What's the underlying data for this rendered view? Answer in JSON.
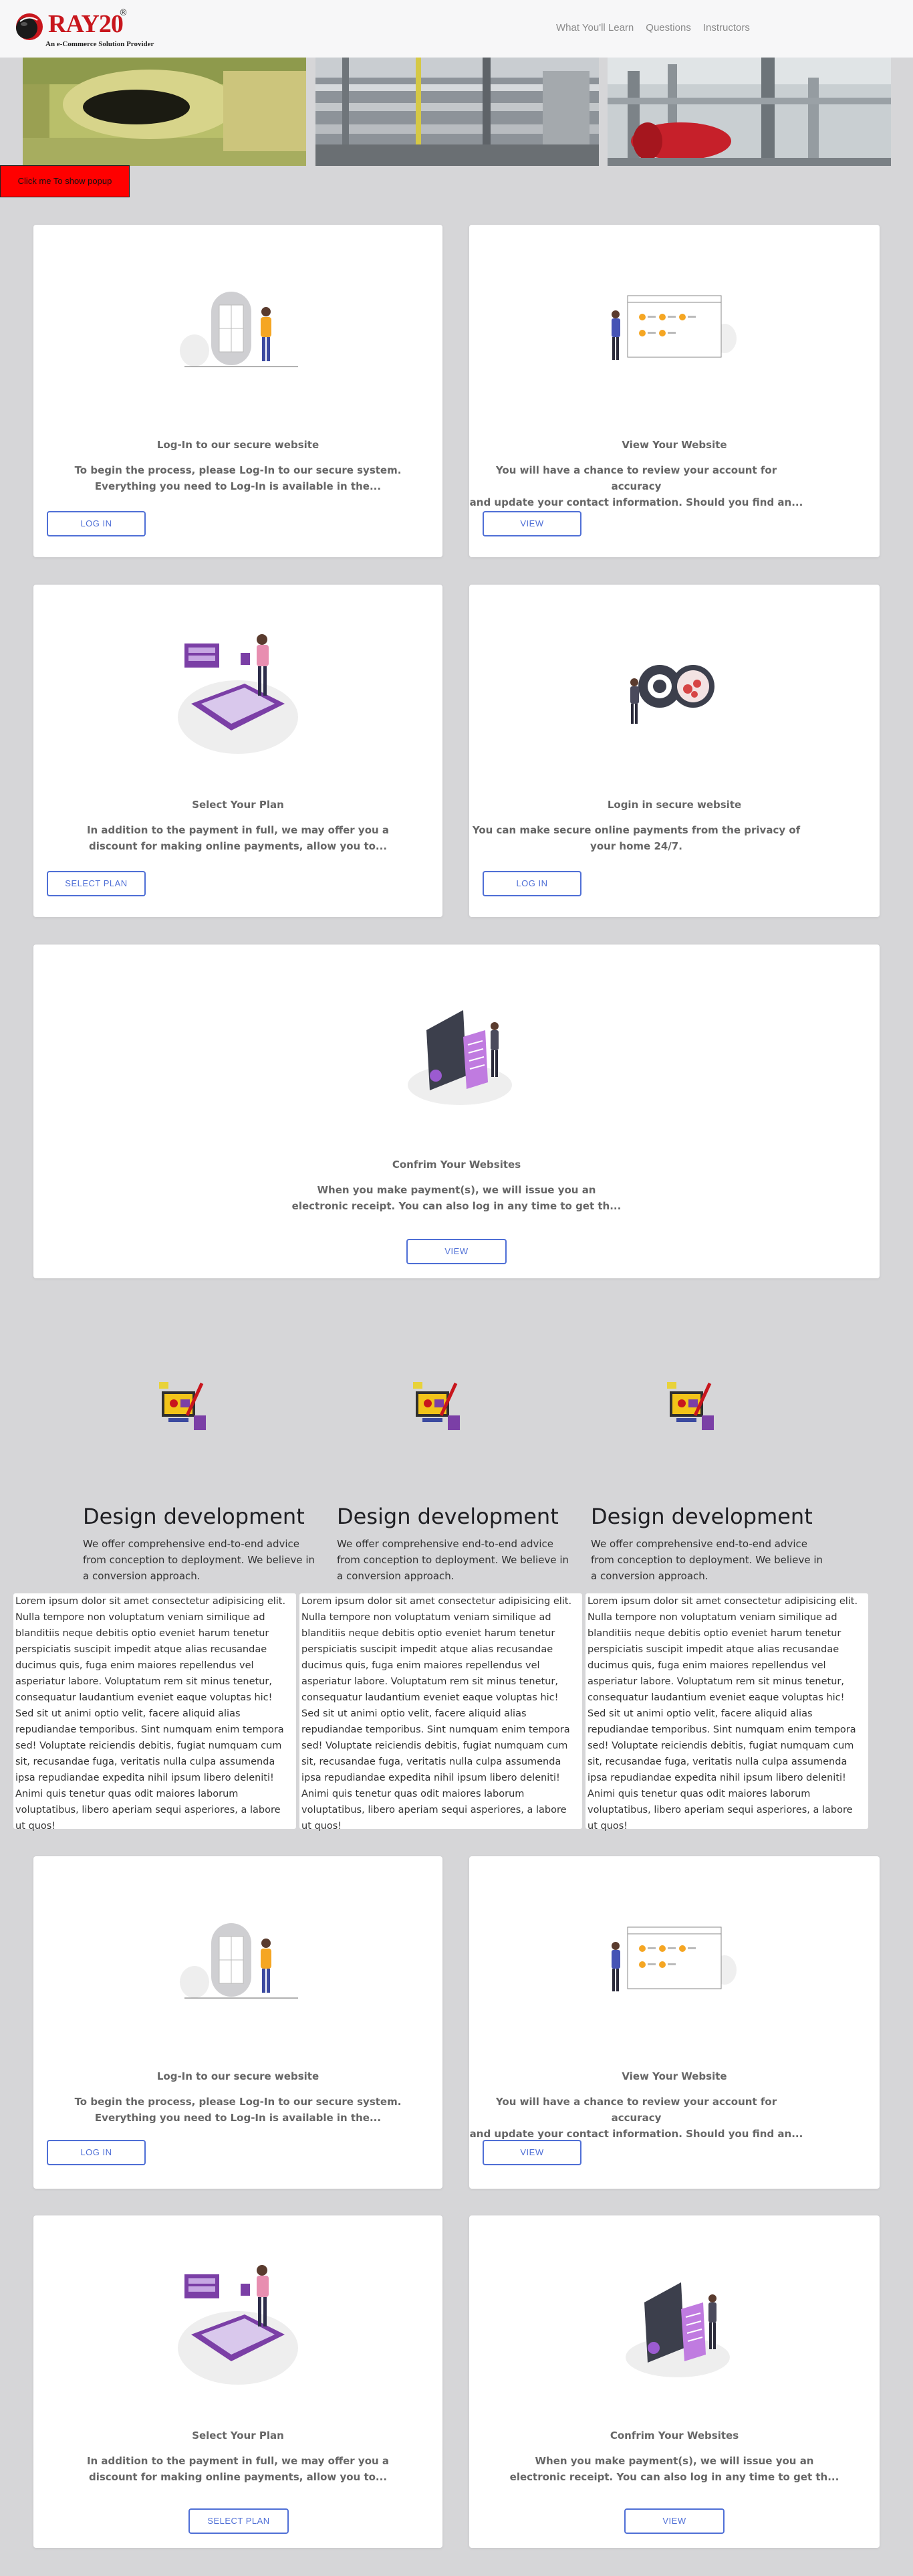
{
  "brand": {
    "name": "RAY20",
    "registered": "®",
    "tagline": "An e-Commerce Solution Provider"
  },
  "nav": {
    "links": [
      "What You'll Learn",
      "Questions",
      "Instructors"
    ]
  },
  "popup_button": "Click me To show popup",
  "cards_top": [
    {
      "title": "Log-In to our secure website",
      "text1": "To begin the process, please Log-In to our secure system.",
      "text2": "Everything you need to Log-In is available in the...",
      "button": "LOG IN"
    },
    {
      "title": "View Your Website",
      "text1": "You will have a chance to review your account for accuracy",
      "text2": "and update your contact information. Should you find an...",
      "button": "VIEW"
    },
    {
      "title": "Select Your Plan",
      "text1": "In addition to the payment in full, we may offer you a",
      "text2": "discount for making online payments, allow you to...",
      "button": "SELECT PLAN"
    },
    {
      "title": "Login in secure website",
      "text1": "You can make secure online payments from the privacy of",
      "text2": "your home 24/7.",
      "button": "LOG IN"
    },
    {
      "title": "Confrim Your Websites",
      "text1": "When you make payment(s), we will issue you an",
      "text2": "electronic receipt. You can also log in any time to get th...",
      "button": "VIEW"
    }
  ],
  "design_columns": [
    {
      "title": "Design development",
      "desc": "We offer comprehensive end-to-end advice from conception to deployment. We believe in a conversion approach."
    },
    {
      "title": "Design development",
      "desc": "We offer comprehensive end-to-end advice from conception to deployment. We believe in a conversion approach."
    },
    {
      "title": "Design development",
      "desc": "We offer comprehensive end-to-end advice from conception to deployment. We believe in a conversion approach."
    }
  ],
  "lorem_text": "Lorem ipsum dolor sit amet consectetur adipisicing elit. Nulla tempore non voluptatum veniam similique ad blanditiis neque debitis optio eveniet harum tenetur perspiciatis suscipit impedit atque alias recusandae ducimus quis, fuga enim maiores repellendus vel asperiatur labore. Voluptatum rem sit minus tenetur, consequatur laudantium eveniet eaque voluptas hic! Sed sit ut animi optio velit, facere aliquid alias repudiandae temporibus. Sint numquam enim tempora sed! Voluptate reiciendis debitis, fugiat numquam cum sit, recusandae fuga, veritatis nulla culpa assumenda ipsa repudiandae expedita nihil ipsum libero deleniti! Animi quis tenetur quas odit maiores laborum voluptatibus, libero aperiam sequi asperiores, a labore ut quos!",
  "cards_bottom": [
    {
      "title": "Log-In to our secure website",
      "text1": "To begin the process, please Log-In to our secure system.",
      "text2": "Everything you need to Log-In is available in the...",
      "button": "LOG IN"
    },
    {
      "title": "View Your Website",
      "text1": "You will have a chance to review your account for accuracy",
      "text2": "and update your contact information. Should you find an...",
      "button": "VIEW"
    },
    {
      "title": "Select Your Plan",
      "text1": "In addition to the payment in full, we may offer you a",
      "text2": "discount for making online payments, allow you to...",
      "button": "SELECT PLAN"
    },
    {
      "title": "Confrim Your Websites",
      "text1": "When you make payment(s), we will issue you an",
      "text2": "electronic receipt. You can also log in any time to get th...",
      "button": "VIEW"
    }
  ],
  "colors": {
    "background": "#d6d6d8",
    "brand_red": "#c8161d",
    "button_blue": "#4f6fd6",
    "popup_red": "#ff0000",
    "illustration_purple": "#7b3fa6"
  }
}
